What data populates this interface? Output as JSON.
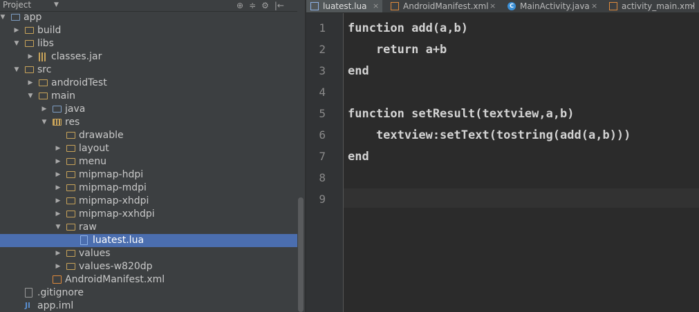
{
  "project_panel": {
    "title": "Project",
    "caret": "▼",
    "tools": [
      "⊕",
      "≑",
      "⚙",
      "|←"
    ],
    "tree": [
      {
        "label": "app",
        "depth": 0,
        "arrow": "▼",
        "icon": "mod",
        "name": "tree-item-app"
      },
      {
        "label": "build",
        "depth": 1,
        "arrow": "▶",
        "icon": "folder",
        "name": "tree-item-build"
      },
      {
        "label": "libs",
        "depth": 1,
        "arrow": "▼",
        "icon": "folder",
        "name": "tree-item-libs"
      },
      {
        "label": "classes.jar",
        "depth": 2,
        "arrow": "▶",
        "icon": "jar",
        "name": "tree-item-classes-jar"
      },
      {
        "label": "src",
        "depth": 1,
        "arrow": "▼",
        "icon": "folder",
        "name": "tree-item-src"
      },
      {
        "label": "androidTest",
        "depth": 2,
        "arrow": "▶",
        "icon": "folder",
        "name": "tree-item-androidtest"
      },
      {
        "label": "main",
        "depth": 2,
        "arrow": "▼",
        "icon": "folder",
        "name": "tree-item-main"
      },
      {
        "label": "java",
        "depth": 3,
        "arrow": "▶",
        "icon": "mod",
        "name": "tree-item-java"
      },
      {
        "label": "res",
        "depth": 3,
        "arrow": "▼",
        "icon": "res",
        "name": "tree-item-res"
      },
      {
        "label": "drawable",
        "depth": 4,
        "arrow": "",
        "icon": "folder",
        "name": "tree-item-drawable"
      },
      {
        "label": "layout",
        "depth": 4,
        "arrow": "▶",
        "icon": "folder",
        "name": "tree-item-layout"
      },
      {
        "label": "menu",
        "depth": 4,
        "arrow": "▶",
        "icon": "folder",
        "name": "tree-item-menu"
      },
      {
        "label": "mipmap-hdpi",
        "depth": 4,
        "arrow": "▶",
        "icon": "folder",
        "name": "tree-item-mipmap-hdpi"
      },
      {
        "label": "mipmap-mdpi",
        "depth": 4,
        "arrow": "▶",
        "icon": "folder",
        "name": "tree-item-mipmap-mdpi"
      },
      {
        "label": "mipmap-xhdpi",
        "depth": 4,
        "arrow": "▶",
        "icon": "folder",
        "name": "tree-item-mipmap-xhdpi"
      },
      {
        "label": "mipmap-xxhdpi",
        "depth": 4,
        "arrow": "▶",
        "icon": "folder",
        "name": "tree-item-mipmap-xxhdpi"
      },
      {
        "label": "raw",
        "depth": 4,
        "arrow": "▼",
        "icon": "folder",
        "name": "tree-item-raw"
      },
      {
        "label": "luatest.lua",
        "depth": 5,
        "arrow": "",
        "icon": "lua",
        "name": "tree-item-luatest-lua",
        "selected": true
      },
      {
        "label": "values",
        "depth": 4,
        "arrow": "▶",
        "icon": "folder",
        "name": "tree-item-values"
      },
      {
        "label": "values-w820dp",
        "depth": 4,
        "arrow": "▶",
        "icon": "folder",
        "name": "tree-item-values-w820dp"
      },
      {
        "label": "AndroidManifest.xml",
        "depth": 3,
        "arrow": "",
        "icon": "xml",
        "name": "tree-item-androidmanifest"
      },
      {
        "label": ".gitignore",
        "depth": 1,
        "arrow": "",
        "icon": "git",
        "name": "tree-item-gitignore"
      },
      {
        "label": "app.iml",
        "depth": 1,
        "arrow": "",
        "icon": "iml",
        "name": "tree-item-app-iml"
      }
    ]
  },
  "tabs": [
    {
      "label": "luatest.lua",
      "icon": "lua",
      "active": true,
      "name": "tab-luatest-lua"
    },
    {
      "label": "AndroidManifest.xml",
      "icon": "xml",
      "active": false,
      "name": "tab-androidmanifest"
    },
    {
      "label": "MainActivity.java",
      "icon": "java",
      "active": false,
      "name": "tab-mainactivity"
    },
    {
      "label": "activity_main.xml",
      "icon": "xml",
      "active": false,
      "name": "tab-activity-main"
    }
  ],
  "close_glyph": "×",
  "java_icon_letter": "C",
  "iml_icon_glyph": "Jl",
  "editor": {
    "lines": [
      {
        "num": "1",
        "code": "function add(a,b)"
      },
      {
        "num": "2",
        "code": "    return a+b"
      },
      {
        "num": "3",
        "code": "end"
      },
      {
        "num": "4",
        "code": ""
      },
      {
        "num": "5",
        "code": "function setResult(textview,a,b)"
      },
      {
        "num": "6",
        "code": "    textview:setText(tostring(add(a,b)))"
      },
      {
        "num": "7",
        "code": "end"
      },
      {
        "num": "8",
        "code": ""
      },
      {
        "num": "9",
        "code": ""
      }
    ],
    "current_line": 9
  }
}
